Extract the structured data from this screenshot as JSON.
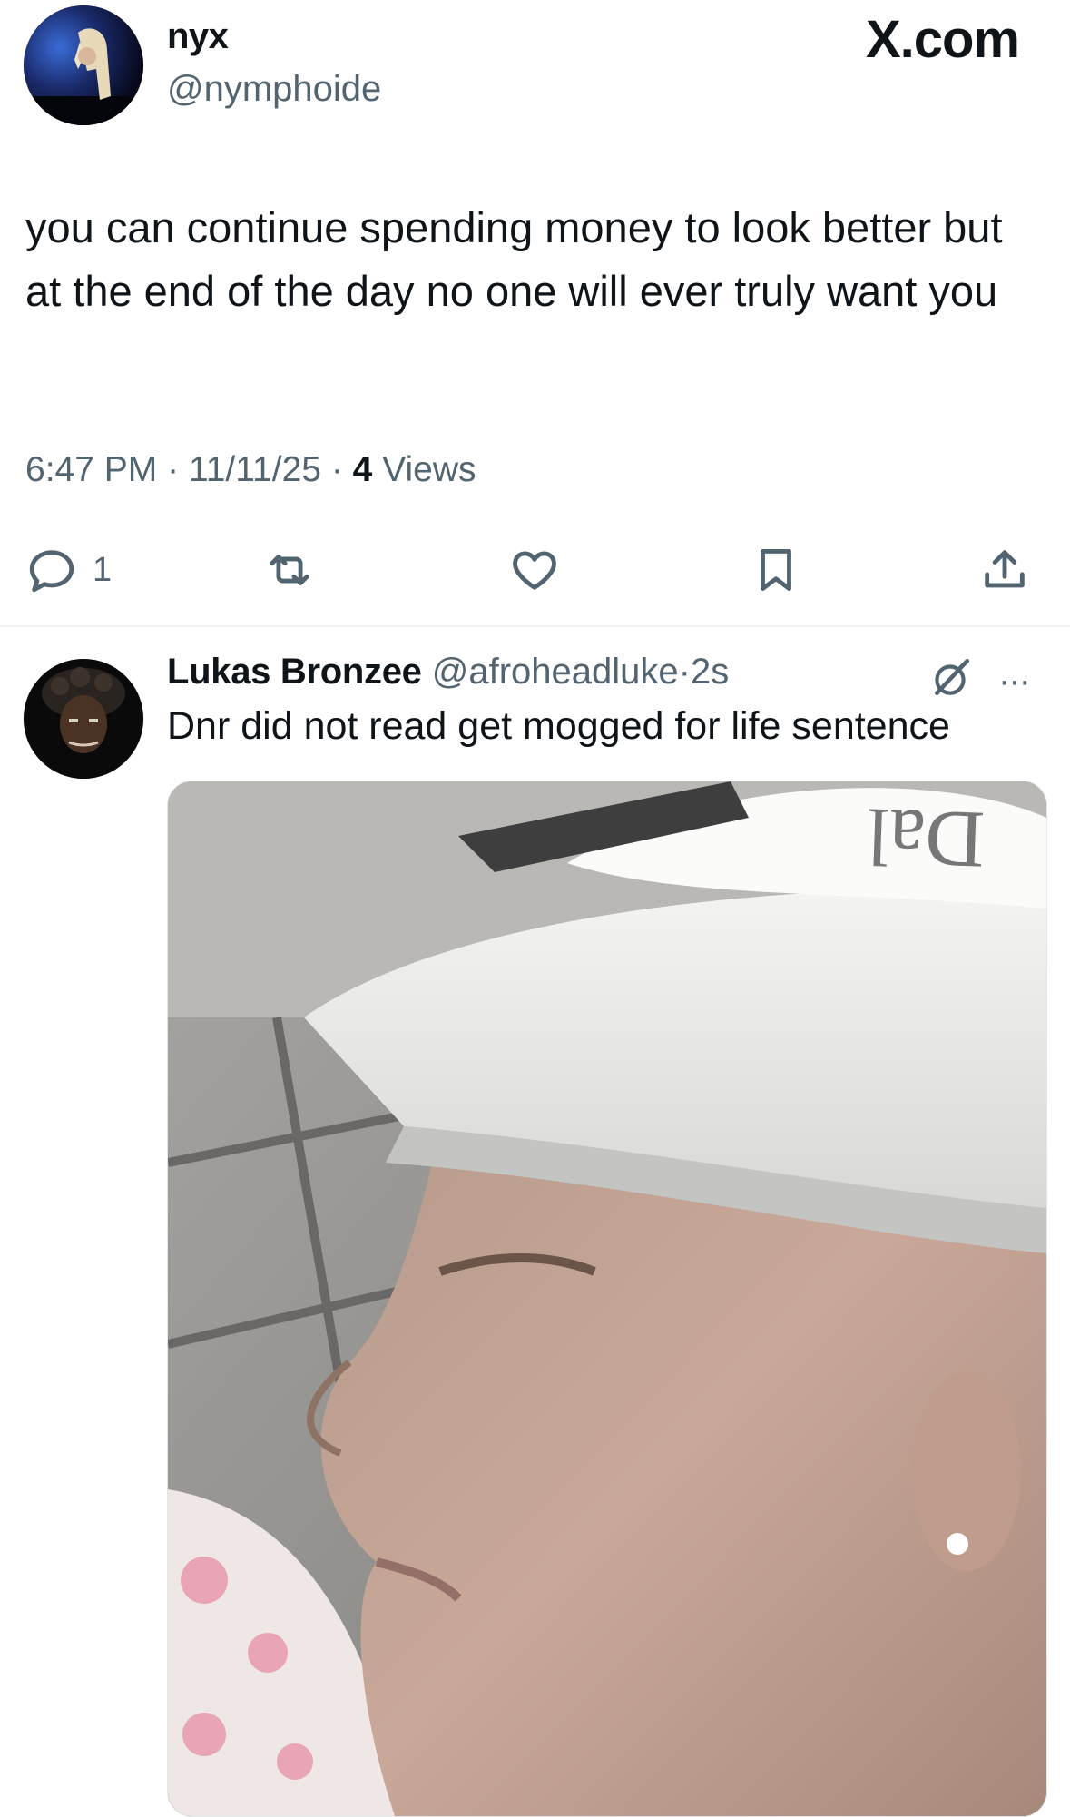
{
  "tweet": {
    "author_name": "nyx",
    "author_handle": "@nymphoide",
    "site_label": "X.com",
    "text": "you can continue spending money to look better but at the end of the day no one will ever truly want you",
    "time": "6:47 PM",
    "date": "11/11/25",
    "views_count": "4",
    "views_label": "Views",
    "separator": "·",
    "actions": {
      "reply_icon": "speech-bubble-icon",
      "reply_count": "1",
      "retweet_icon": "retweet-icon",
      "like_icon": "heart-icon",
      "bookmark_icon": "bookmark-icon",
      "share_icon": "share-upload-icon"
    }
  },
  "reply": {
    "author_name": "Lukas Bronzee",
    "author_handle": "@afroheadluke",
    "separator": "·",
    "time": "2s",
    "text": "Dnr did not read get mogged for life sentence",
    "icons": [
      "grok-slash-icon",
      "more-dots-icon"
    ],
    "more_label": "···"
  },
  "colors": {
    "text": "#0f1419",
    "secondary": "#536471",
    "divider": "#eff3f4",
    "background": "#ffffff"
  }
}
